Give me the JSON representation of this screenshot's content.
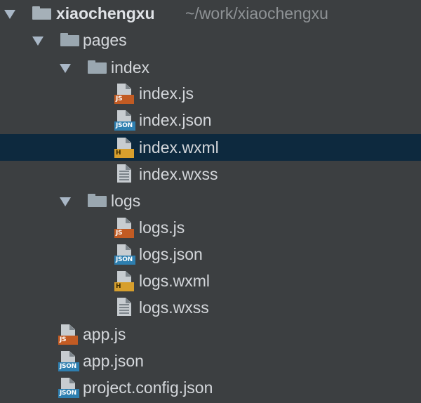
{
  "project_tree": {
    "root": {
      "name": "xiaochengxu",
      "path": "~/work/xiaochengxu"
    },
    "items": [
      {
        "label": "pages",
        "type": "folder"
      },
      {
        "label": "index",
        "type": "folder"
      },
      {
        "label": "index.js",
        "type": "file",
        "icon": "js-file-icon",
        "badge": "JS"
      },
      {
        "label": "index.json",
        "type": "file",
        "icon": "json-file-icon",
        "badge": "JSON"
      },
      {
        "label": "index.wxml",
        "type": "file",
        "icon": "html-file-icon",
        "badge": "H",
        "selected": true
      },
      {
        "label": "index.wxss",
        "type": "file",
        "icon": "text-file-icon"
      },
      {
        "label": "logs",
        "type": "folder"
      },
      {
        "label": "logs.js",
        "type": "file",
        "icon": "js-file-icon",
        "badge": "JS"
      },
      {
        "label": "logs.json",
        "type": "file",
        "icon": "json-file-icon",
        "badge": "JSON"
      },
      {
        "label": "logs.wxml",
        "type": "file",
        "icon": "html-file-icon",
        "badge": "H"
      },
      {
        "label": "logs.wxss",
        "type": "file",
        "icon": "text-file-icon"
      },
      {
        "label": "app.js",
        "type": "file",
        "icon": "js-file-icon",
        "badge": "JS"
      },
      {
        "label": "app.json",
        "type": "file",
        "icon": "json-file-icon",
        "badge": "JSON"
      },
      {
        "label": "project.config.json",
        "type": "file",
        "icon": "json-file-icon",
        "badge": "JSON"
      }
    ]
  },
  "colors": {
    "background": "#3c3f41",
    "selection": "#0d293e",
    "js_badge": "#c25b23",
    "json_badge": "#2e7fb0",
    "html_badge": "#d79f2d",
    "folder": "#9aa7b0"
  }
}
